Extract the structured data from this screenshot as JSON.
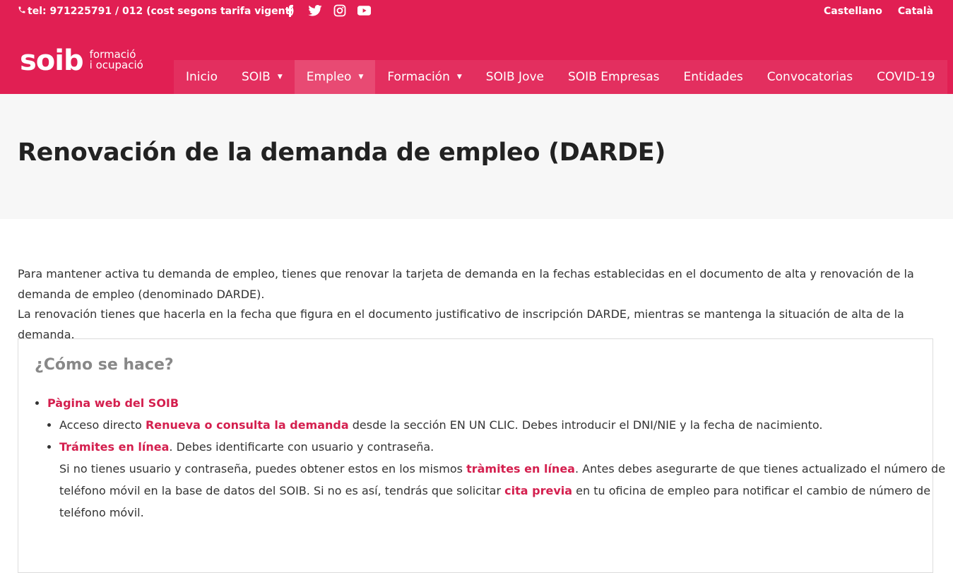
{
  "colors": {
    "brand": "#e11f53",
    "nav_bg": "#e32f5f",
    "nav_active": "#e84a73",
    "link": "#d41f4e",
    "title_band": "#f7f7f7"
  },
  "topbar": {
    "phone": "tel: 971225791 / 012 (cost segons tarifa vigent)",
    "social_icons": [
      "facebook-icon",
      "twitter-icon",
      "instagram-icon",
      "youtube-icon"
    ],
    "languages": [
      "Castellano",
      "Català"
    ]
  },
  "logo": {
    "main": "soib",
    "sub_line1": "formació",
    "sub_line2": "i ocupació"
  },
  "nav": {
    "items": [
      {
        "label": "Inicio"
      },
      {
        "label": "SOIB"
      },
      {
        "label": "Empleo"
      },
      {
        "label": "Formación"
      },
      {
        "label": "SOIB Jove"
      },
      {
        "label": "SOIB Empresas"
      },
      {
        "label": "Entidades"
      },
      {
        "label": "Convocatorias"
      },
      {
        "label": "COVID-19"
      }
    ],
    "active": "Empleo"
  },
  "page": {
    "title": "Renovación de la demanda de empleo (DARDE)",
    "intro_p1": "Para mantener activa tu demanda de empleo, tienes que renovar la tarjeta de demanda en la fechas establecidas en el documento de alta y renovación de la demanda de empleo (denominado DARDE).",
    "intro_p2": "La renovación tienes que hacerla en la fecha que figura en el documento justificativo de inscripción DARDE, mientras se mantenga la situación de alta de la demanda."
  },
  "how": {
    "heading": "¿Cómo se hace?",
    "item1_link": "Pàgina web del SOIB",
    "sub1_pre": "Acceso directo ",
    "sub1_link": "Renueva o consulta la demanda",
    "sub1_post": " desde la sección EN UN CLIC. Debes introducir el DNI/NIE y la fecha de nacimiento.",
    "sub2_link": "Trámites en línea",
    "sub2_post": ". Debes identificarte con usuario y contraseña.",
    "sub2_p2_pre": "Si no tienes usuario y contraseña, puedes obtener estos en los mismos ",
    "sub2_p2_link1": "tràmites en línea",
    "sub2_p2_mid": ". Antes debes asegurarte de que tienes actualizado el número de teléfono móvil en la base de datos del SOIB. Si no es así, tendrás que solicitar ",
    "sub2_p2_link2": "cita previa",
    "sub2_p2_post": " en tu oficina de empleo para notificar el cambio de número de teléfono móvil."
  }
}
